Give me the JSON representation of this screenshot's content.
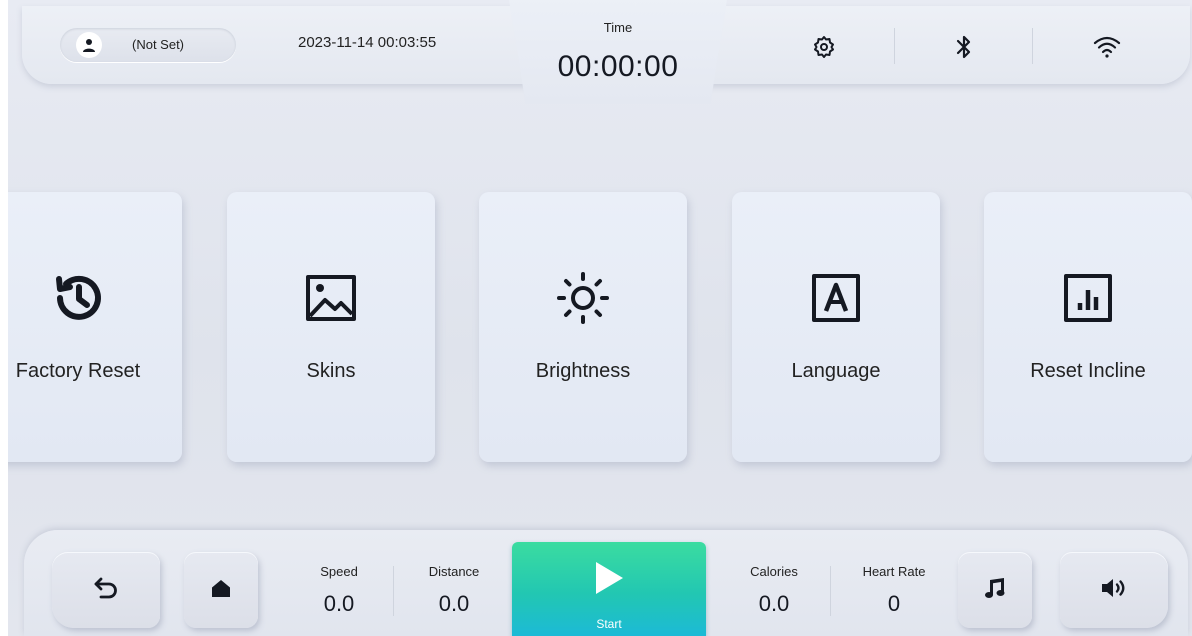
{
  "header": {
    "user_name": "(Not Set)",
    "datetime": "2023-11-14 00:03:55",
    "timer_label": "Time",
    "timer_value": "00:00:00",
    "icons": [
      "user-icon",
      "settings-gear-icon",
      "bluetooth-icon",
      "wifi-icon"
    ]
  },
  "tiles": [
    {
      "label": "Factory Reset",
      "icon": "history-icon"
    },
    {
      "label": "Skins",
      "icon": "image-icon"
    },
    {
      "label": "Brightness",
      "icon": "sun-icon"
    },
    {
      "label": "Language",
      "icon": "letter-a-icon"
    },
    {
      "label": "Reset Incline",
      "icon": "bar-chart-icon"
    }
  ],
  "footer": {
    "speed": {
      "label": "Speed",
      "value": "0.0"
    },
    "distance": {
      "label": "Distance",
      "value": "0.0"
    },
    "start_label": "Start",
    "calories": {
      "label": "Calories",
      "value": "0.0"
    },
    "heart_rate": {
      "label": "Heart Rate",
      "value": "0"
    },
    "icons": [
      "back-icon",
      "home-icon",
      "play-icon",
      "music-icon",
      "volume-icon"
    ]
  },
  "colors": {
    "background": "#e3e7ef",
    "start_gradient_top": "#3bdca0",
    "start_gradient_bottom": "#1cbad6",
    "icon_dark": "#151922"
  }
}
